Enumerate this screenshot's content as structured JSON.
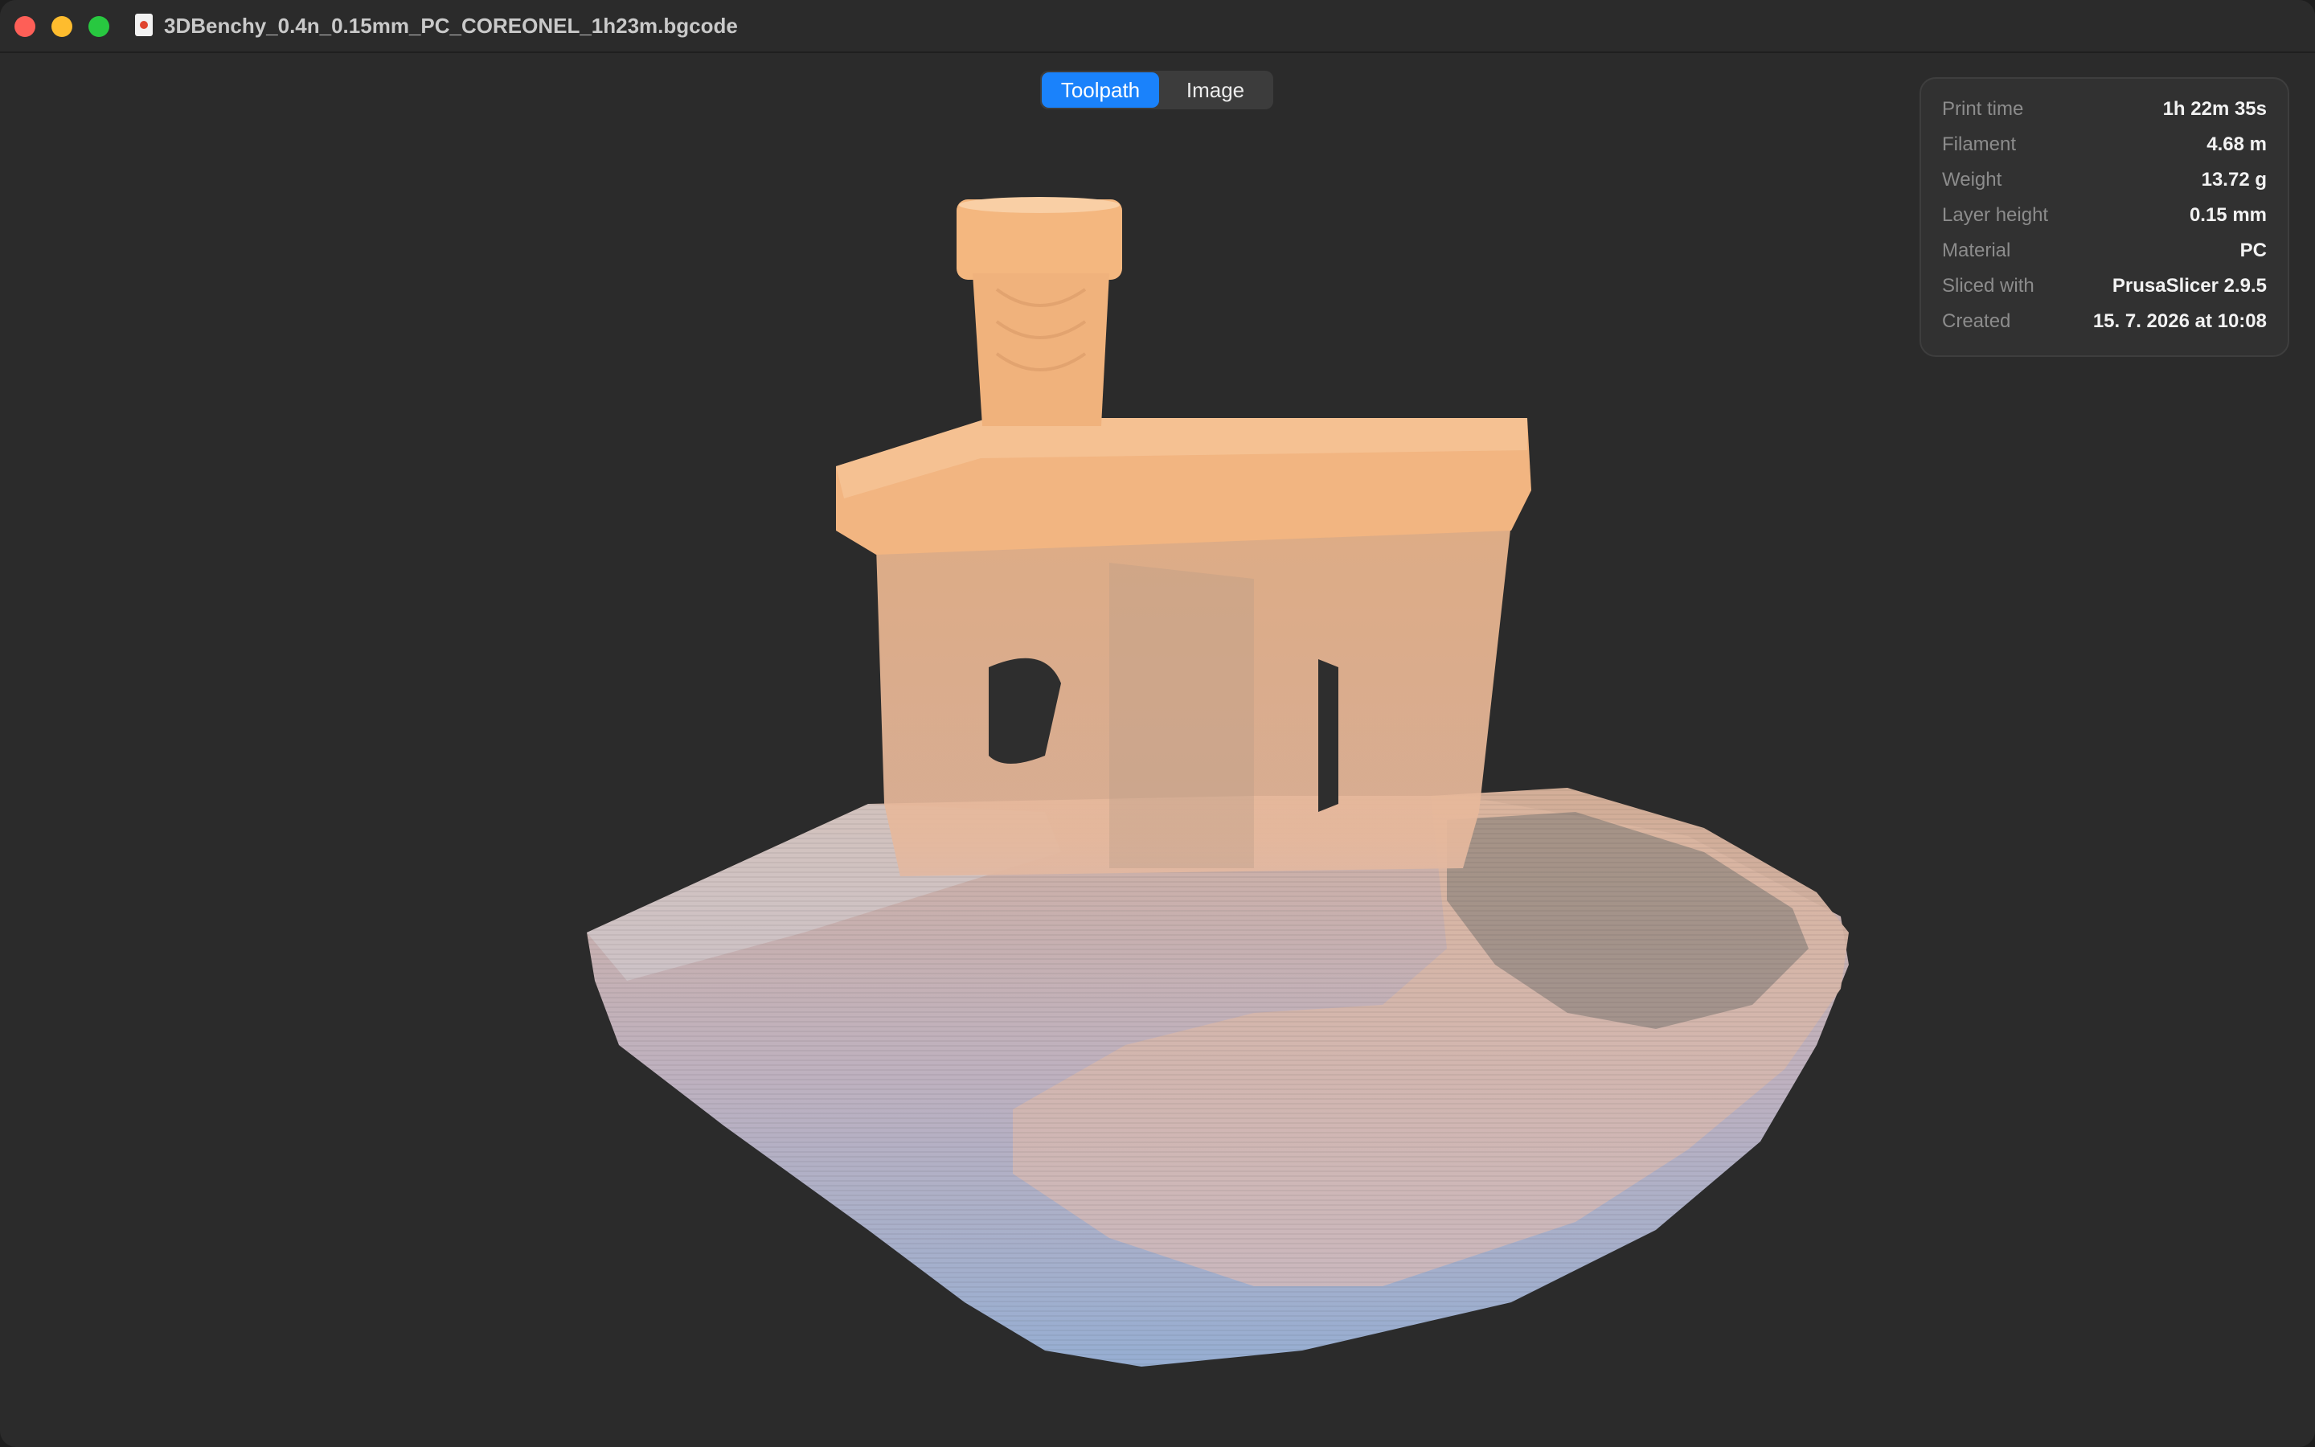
{
  "window": {
    "title": "3DBenchy_0.4n_0.15mm_PC_COREONEL_1h23m.bgcode",
    "file_icon": "bgcode-file-icon"
  },
  "view_toggle": {
    "options": [
      {
        "label": "Toolpath",
        "selected": true
      },
      {
        "label": "Image",
        "selected": false
      }
    ]
  },
  "info": {
    "rows": [
      {
        "label": "Print time",
        "value": "1h 22m 35s"
      },
      {
        "label": "Filament",
        "value": "4.68 m"
      },
      {
        "label": "Weight",
        "value": "13.72 g"
      },
      {
        "label": "Layer height",
        "value": "0.15 mm"
      },
      {
        "label": "Material",
        "value": "PC"
      },
      {
        "label": "Sliced with",
        "value": "PrusaSlicer 2.9.5"
      },
      {
        "label": "Created",
        "value": "15. 7. 2026 at 10:08"
      }
    ]
  },
  "colors": {
    "accent": "#1a82fb",
    "toolpath_top": "#f2b882",
    "toolpath_bottom": "#93b2dc",
    "background": "#2b2b2b"
  }
}
